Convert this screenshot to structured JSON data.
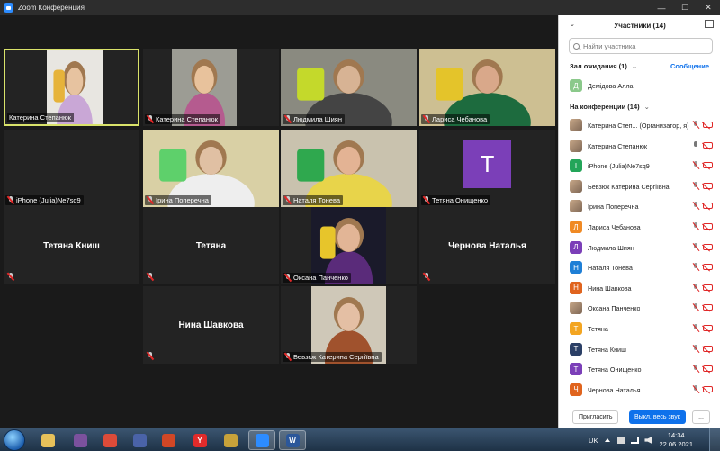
{
  "window": {
    "title": "Zoom Конференция"
  },
  "grid": {
    "tiles": [
      {
        "name": "Катерина Степанюк",
        "kind": "video",
        "active": true
      },
      {
        "name": "Катерина Степанюк",
        "kind": "video"
      },
      {
        "name": "Людмила Шиян",
        "kind": "video"
      },
      {
        "name": "Лариса Чебанова",
        "kind": "video"
      },
      {
        "name": "iPhone (Julia)Ne7sq9",
        "kind": "empty"
      },
      {
        "name": "Ірина Поперечна",
        "kind": "video"
      },
      {
        "name": "Наталя Тонева",
        "kind": "video"
      },
      {
        "name": "Тетяна Онищенко",
        "kind": "avatar",
        "initial": "Т"
      },
      {
        "name": "Тетяна Книш",
        "kind": "name"
      },
      {
        "name": "Тетяна",
        "kind": "name"
      },
      {
        "name": "Оксана Панченко",
        "kind": "video"
      },
      {
        "name": "Чернова Наталья",
        "kind": "name"
      },
      {
        "name": "Нина Шавкова",
        "kind": "name"
      },
      {
        "name": "Бевзюк Катерина Сергіївна",
        "kind": "video"
      }
    ]
  },
  "panel": {
    "title": "Участники (14)",
    "search_placeholder": "Найти участника",
    "waiting_label": "Зал ожидания (1)",
    "message_link": "Сообщение",
    "waiting": [
      {
        "name": "Демідова Алла",
        "initial": "Д",
        "color": "#8bc98b"
      }
    ],
    "in_meeting_label": "На конференции (14)",
    "participants": [
      {
        "name": "Катерина Степ... (Организатор, я)",
        "photo": true,
        "mic": "muted"
      },
      {
        "name": "Катерина Степанюк",
        "photo": true,
        "mic": "on"
      },
      {
        "name": "iPhone (Julia)Ne7sq9",
        "initial": "I",
        "color": "#23a559",
        "mic": "muted"
      },
      {
        "name": "Бевзюк Катерина Сергіївна",
        "photo": true,
        "mic": "muted"
      },
      {
        "name": "Ірина Поперечна",
        "photo": true,
        "mic": "muted"
      },
      {
        "name": "Лариса Чебанова",
        "initial": "Л",
        "color": "#f08a24",
        "mic": "muted"
      },
      {
        "name": "Людмила Шиян",
        "initial": "Л",
        "color": "#7b3fb8",
        "mic": "muted"
      },
      {
        "name": "Наталя Тонева",
        "initial": "Н",
        "color": "#1f7fd6",
        "mic": "muted"
      },
      {
        "name": "Нина Шавкова",
        "initial": "Н",
        "color": "#e0641e",
        "mic": "muted"
      },
      {
        "name": "Оксана Панченко",
        "photo": true,
        "mic": "muted"
      },
      {
        "name": "Тетяна",
        "initial": "Т",
        "color": "#f3a521",
        "mic": "muted"
      },
      {
        "name": "Тетяна Книш",
        "initial": "Т",
        "color": "#2b3f66",
        "mic": "muted"
      },
      {
        "name": "Тетяна Онищенко",
        "initial": "Т",
        "color": "#7b3fb8",
        "mic": "muted"
      },
      {
        "name": "Чернова Наталья",
        "initial": "Ч",
        "color": "#e0641e",
        "mic": "muted"
      }
    ],
    "invite_label": "Пригласить",
    "mute_all_label": "Выкл. весь звук",
    "more_label": "..."
  },
  "taskbar": {
    "language": "UK",
    "time": "14:34",
    "date": "22.06.2021",
    "apps": [
      {
        "icon": "folder-icon",
        "color": "#e7c15a",
        "glyph": ""
      },
      {
        "icon": "viber-icon",
        "color": "#7b519d",
        "glyph": ""
      },
      {
        "icon": "chrome-icon",
        "color": "#dd4b39",
        "glyph": ""
      },
      {
        "icon": "floppy-icon",
        "color": "#4a63a8",
        "glyph": ""
      },
      {
        "icon": "powerpoint-icon",
        "color": "#d24726",
        "glyph": ""
      },
      {
        "icon": "yandex-icon",
        "color": "#e12b2b",
        "glyph": "Y"
      },
      {
        "icon": "winrar-icon",
        "color": "#c7a23a",
        "glyph": ""
      },
      {
        "icon": "zoom-icon",
        "color": "#2d8cff",
        "glyph": ""
      },
      {
        "icon": "word-icon",
        "color": "#2b579a",
        "glyph": "W"
      }
    ]
  }
}
